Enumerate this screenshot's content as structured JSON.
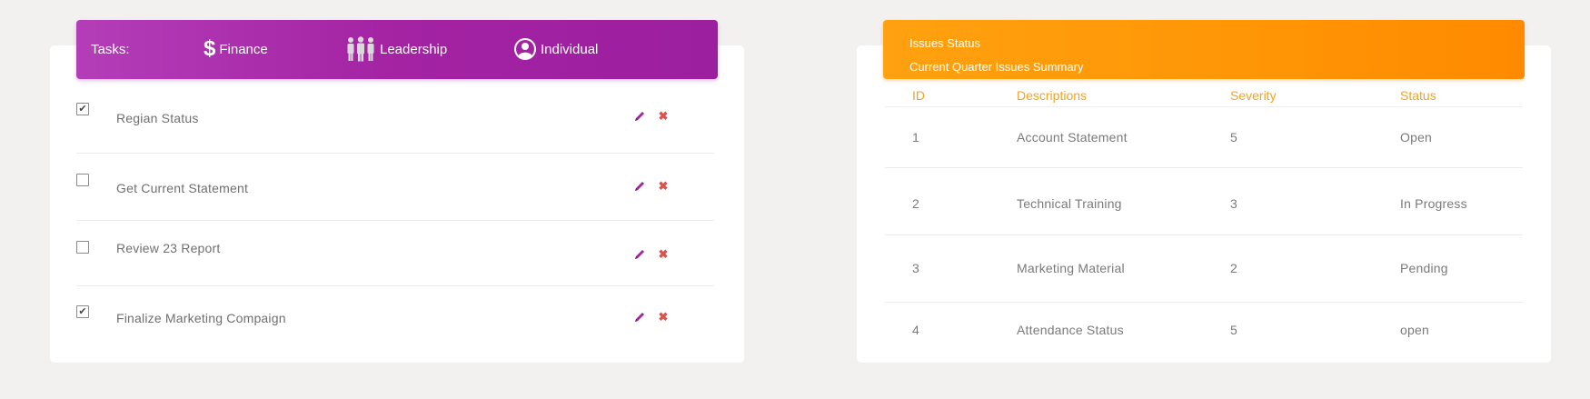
{
  "tasks": {
    "title": "Tasks:",
    "tabs": [
      {
        "label": "Finance",
        "icon": "dollar-icon"
      },
      {
        "label": "Leadership",
        "icon": "people-icon"
      },
      {
        "label": "Individual",
        "icon": "user-circle-icon"
      }
    ],
    "items": [
      {
        "label": "Regian Status",
        "checked": true
      },
      {
        "label": "Get Current Statement",
        "checked": false
      },
      {
        "label": "Review 23 Report",
        "checked": false
      },
      {
        "label": "Finalize Marketing Compaign",
        "checked": true
      }
    ],
    "check_glyph": "✔",
    "delete_glyph": "✖"
  },
  "issues": {
    "title": "Issues Status",
    "subtitle": "Current Quarter Issues Summary",
    "columns": [
      "ID",
      "Descriptions",
      "Severity",
      "Status"
    ],
    "rows": [
      {
        "id": "1",
        "description": "Account Statement",
        "severity": "5",
        "status": "Open"
      },
      {
        "id": "2",
        "description": "Technical Training",
        "severity": "3",
        "status": "In Progress"
      },
      {
        "id": "3",
        "description": "Marketing Material",
        "severity": "2",
        "status": "Pending"
      },
      {
        "id": "4",
        "description": "Attendance Status",
        "severity": "5",
        "status": "open"
      }
    ]
  },
  "colors": {
    "tasks_accent": "#a323a3",
    "issues_accent": "#ff9505",
    "delete": "#d9534f",
    "background": "#f2f1ef"
  }
}
